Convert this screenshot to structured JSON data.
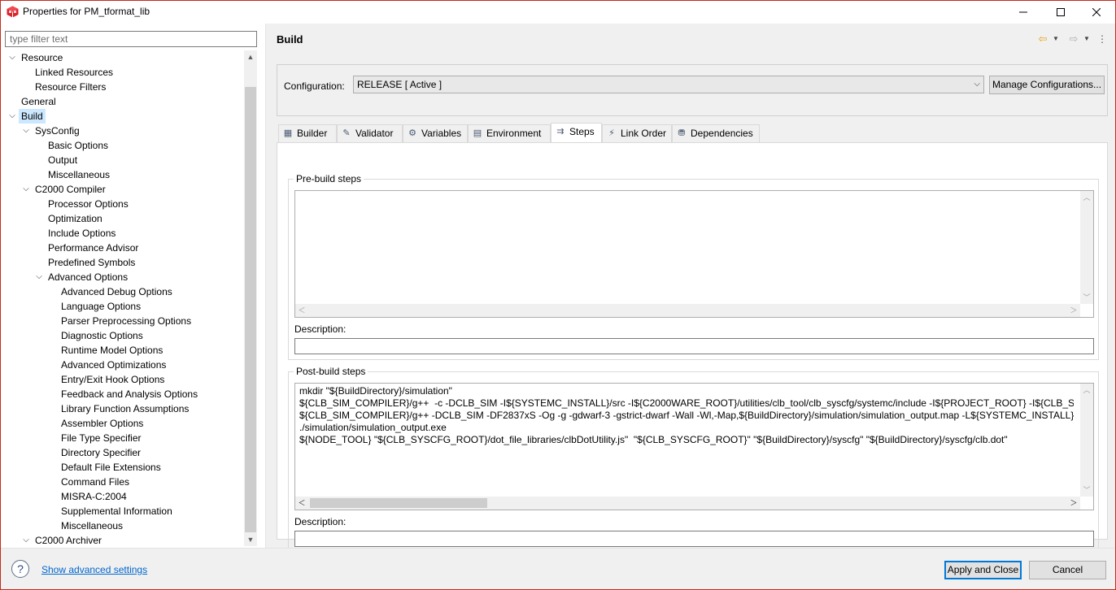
{
  "window": {
    "title": "Properties for PM_tformat_lib",
    "minimize": "—",
    "maximize": "☐",
    "close": "✕"
  },
  "filter": {
    "placeholder": "type filter text"
  },
  "tree": [
    {
      "label": "Resource",
      "level": 0,
      "expanded": true
    },
    {
      "label": "Linked Resources",
      "level": 1
    },
    {
      "label": "Resource Filters",
      "level": 1
    },
    {
      "label": "General",
      "level": 0
    },
    {
      "label": "Build",
      "level": 0,
      "expanded": true,
      "selected": true
    },
    {
      "label": "SysConfig",
      "level": 1,
      "expanded": true
    },
    {
      "label": "Basic Options",
      "level": 2
    },
    {
      "label": "Output",
      "level": 2
    },
    {
      "label": "Miscellaneous",
      "level": 2
    },
    {
      "label": "C2000 Compiler",
      "level": 1,
      "expanded": true
    },
    {
      "label": "Processor Options",
      "level": 2
    },
    {
      "label": "Optimization",
      "level": 2
    },
    {
      "label": "Include Options",
      "level": 2
    },
    {
      "label": "Performance Advisor",
      "level": 2
    },
    {
      "label": "Predefined Symbols",
      "level": 2
    },
    {
      "label": "Advanced Options",
      "level": 2,
      "expanded": true
    },
    {
      "label": "Advanced Debug Options",
      "level": 3
    },
    {
      "label": "Language Options",
      "level": 3
    },
    {
      "label": "Parser Preprocessing Options",
      "level": 3
    },
    {
      "label": "Diagnostic Options",
      "level": 3
    },
    {
      "label": "Runtime Model Options",
      "level": 3
    },
    {
      "label": "Advanced Optimizations",
      "level": 3
    },
    {
      "label": "Entry/Exit Hook Options",
      "level": 3
    },
    {
      "label": "Feedback and Analysis Options",
      "level": 3
    },
    {
      "label": "Library Function Assumptions",
      "level": 3
    },
    {
      "label": "Assembler Options",
      "level": 3
    },
    {
      "label": "File Type Specifier",
      "level": 3
    },
    {
      "label": "Directory Specifier",
      "level": 3
    },
    {
      "label": "Default File Extensions",
      "level": 3
    },
    {
      "label": "Command Files",
      "level": 3
    },
    {
      "label": "MISRA-C:2004",
      "level": 3
    },
    {
      "label": "Supplemental Information",
      "level": 3
    },
    {
      "label": "Miscellaneous",
      "level": 3
    },
    {
      "label": "C2000 Archiver",
      "level": 1,
      "expanded": true
    }
  ],
  "page": {
    "title": "Build"
  },
  "configuration": {
    "label": "Configuration:",
    "value": "RELEASE  [ Active ]",
    "manage_button": "Manage Configurations..."
  },
  "tabs": [
    {
      "label": "Builder",
      "icon": "builder-icon",
      "glyph": "▦"
    },
    {
      "label": "Validator",
      "icon": "validator-icon",
      "glyph": "✎"
    },
    {
      "label": "Variables",
      "icon": "variables-icon",
      "glyph": "⚙"
    },
    {
      "label": "Environment",
      "icon": "environment-icon",
      "glyph": "▤"
    },
    {
      "label": "Steps",
      "icon": "steps-icon",
      "glyph": "⇉",
      "active": true
    },
    {
      "label": "Link Order",
      "icon": "link-order-icon",
      "glyph": "⚡"
    },
    {
      "label": "Dependencies",
      "icon": "dependencies-icon",
      "glyph": "⛃"
    }
  ],
  "pre_build": {
    "group_label": "Pre-build steps",
    "description_label": "Description:",
    "description_value": ""
  },
  "post_build": {
    "group_label": "Post-build steps",
    "lines": [
      "mkdir \"${BuildDirectory}/simulation\"",
      "${CLB_SIM_COMPILER}/g++  -c -DCLB_SIM -I${SYSTEMC_INSTALL}/src -I${C2000WARE_ROOT}/utilities/clb_tool/clb_syscfg/systemc/include -I${PROJECT_ROOT} -I${CLB_SIM_COMPI",
      "${CLB_SIM_COMPILER}/g++ -DCLB_SIM -DF2837xS -Og -g -gdwarf-3 -gstrict-dwarf -Wall -Wl,-Map,${BuildDirectory}/simulation/simulation_output.map -L${SYSTEMC_INSTALL}/bu",
      "./simulation/simulation_output.exe",
      "${NODE_TOOL} \"${CLB_SYSCFG_ROOT}/dot_file_libraries/clbDotUtility.js\"  \"${CLB_SYSCFG_ROOT}\" \"${BuildDirectory}/syscfg\" \"${BuildDirectory}/syscfg/clb.dot\""
    ],
    "description_label": "Description:",
    "description_value": ""
  },
  "footer": {
    "help_glyph": "?",
    "advanced_link": "Show advanced settings",
    "apply_button": "Apply and Close",
    "cancel_button": "Cancel"
  },
  "colors": {
    "window_border": "#c42b1c",
    "selection": "#cce8ff",
    "link": "#0066cc",
    "default_button_border": "#0078d7"
  }
}
